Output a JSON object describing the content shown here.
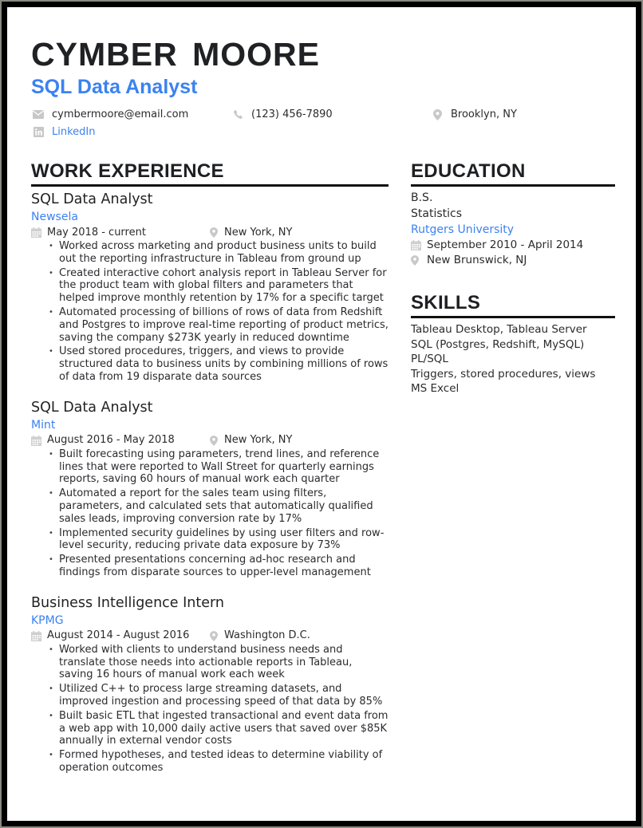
{
  "header": {
    "name": "CYMBER  MOORE",
    "title": "SQL Data Analyst",
    "contacts": {
      "email": {
        "icon": "envelope-icon",
        "text": "cymbermoore@email.com"
      },
      "phone": {
        "icon": "phone-icon",
        "text": "(123) 456-7890"
      },
      "location": {
        "icon": "map-pin-icon",
        "text": "Brooklyn, NY"
      },
      "linkedin": {
        "icon": "linkedin-icon",
        "text": "LinkedIn"
      }
    }
  },
  "colors": {
    "accent": "#3b82f0",
    "text": "#2a2b2e",
    "heading": "#1e1f22",
    "icon": "#c4c4c4",
    "border": "#000000"
  },
  "work": {
    "heading": "WORK EXPERIENCE",
    "jobs": [
      {
        "role": "SQL Data Analyst",
        "company": "Newsela",
        "dates": "May 2018 - current",
        "location": "New York, NY",
        "bullets": [
          "Worked across marketing and product business units to build out the reporting infrastructure in Tableau from ground up",
          "Created interactive cohort analysis report in Tableau Server for the product team with global filters and parameters that helped improve monthly retention by 17% for a specific target",
          "Automated processing of billions of rows of data from Redshift and Postgres to improve real-time reporting of product metrics, saving the company $273K yearly in reduced downtime",
          "Used stored procedures, triggers, and views to provide structured data to business units by combining millions of rows of data from 19 disparate data sources"
        ]
      },
      {
        "role": "SQL Data Analyst",
        "company": "Mint",
        "dates": "August 2016 - May 2018",
        "location": "New York, NY",
        "bullets": [
          "Built forecasting using parameters, trend lines, and reference lines that were reported to Wall Street for quarterly earnings reports, saving 60 hours of manual work each quarter",
          "Automated a report for the sales team using filters, parameters, and calculated sets that automatically qualified sales leads, improving conversion rate by 17%",
          "Implemented security guidelines by using user filters and row-level security, reducing private data exposure by 73%",
          "Presented presentations concerning ad-hoc research and findings from disparate sources to upper-level management"
        ]
      },
      {
        "role": "Business Intelligence Intern",
        "company": "KPMG",
        "dates": "August 2014 - August 2016",
        "location": "Washington D.C.",
        "bullets": [
          "Worked with clients to understand business needs and translate those needs into actionable reports in Tableau, saving 16 hours of manual work each week",
          "Utilized C++ to process large streaming datasets, and improved ingestion and processing speed of that data by 85%",
          "Built basic ETL that ingested transactional and event data from a web app with 10,000 daily active users that saved over $85K annually in external vendor costs",
          "Formed hypotheses, and tested ideas to determine viability of operation outcomes"
        ]
      }
    ]
  },
  "education": {
    "heading": "EDUCATION",
    "degree": "B.S.",
    "field": "Statistics",
    "school": "Rutgers University",
    "dates": "September 2010 - April 2014",
    "location": "New Brunswick, NJ"
  },
  "skills": {
    "heading": "SKILLS",
    "items": [
      "Tableau Desktop, Tableau Server",
      "SQL (Postgres, Redshift, MySQL)",
      "PL/SQL",
      "Triggers, stored procedures, views",
      "MS Excel"
    ]
  }
}
